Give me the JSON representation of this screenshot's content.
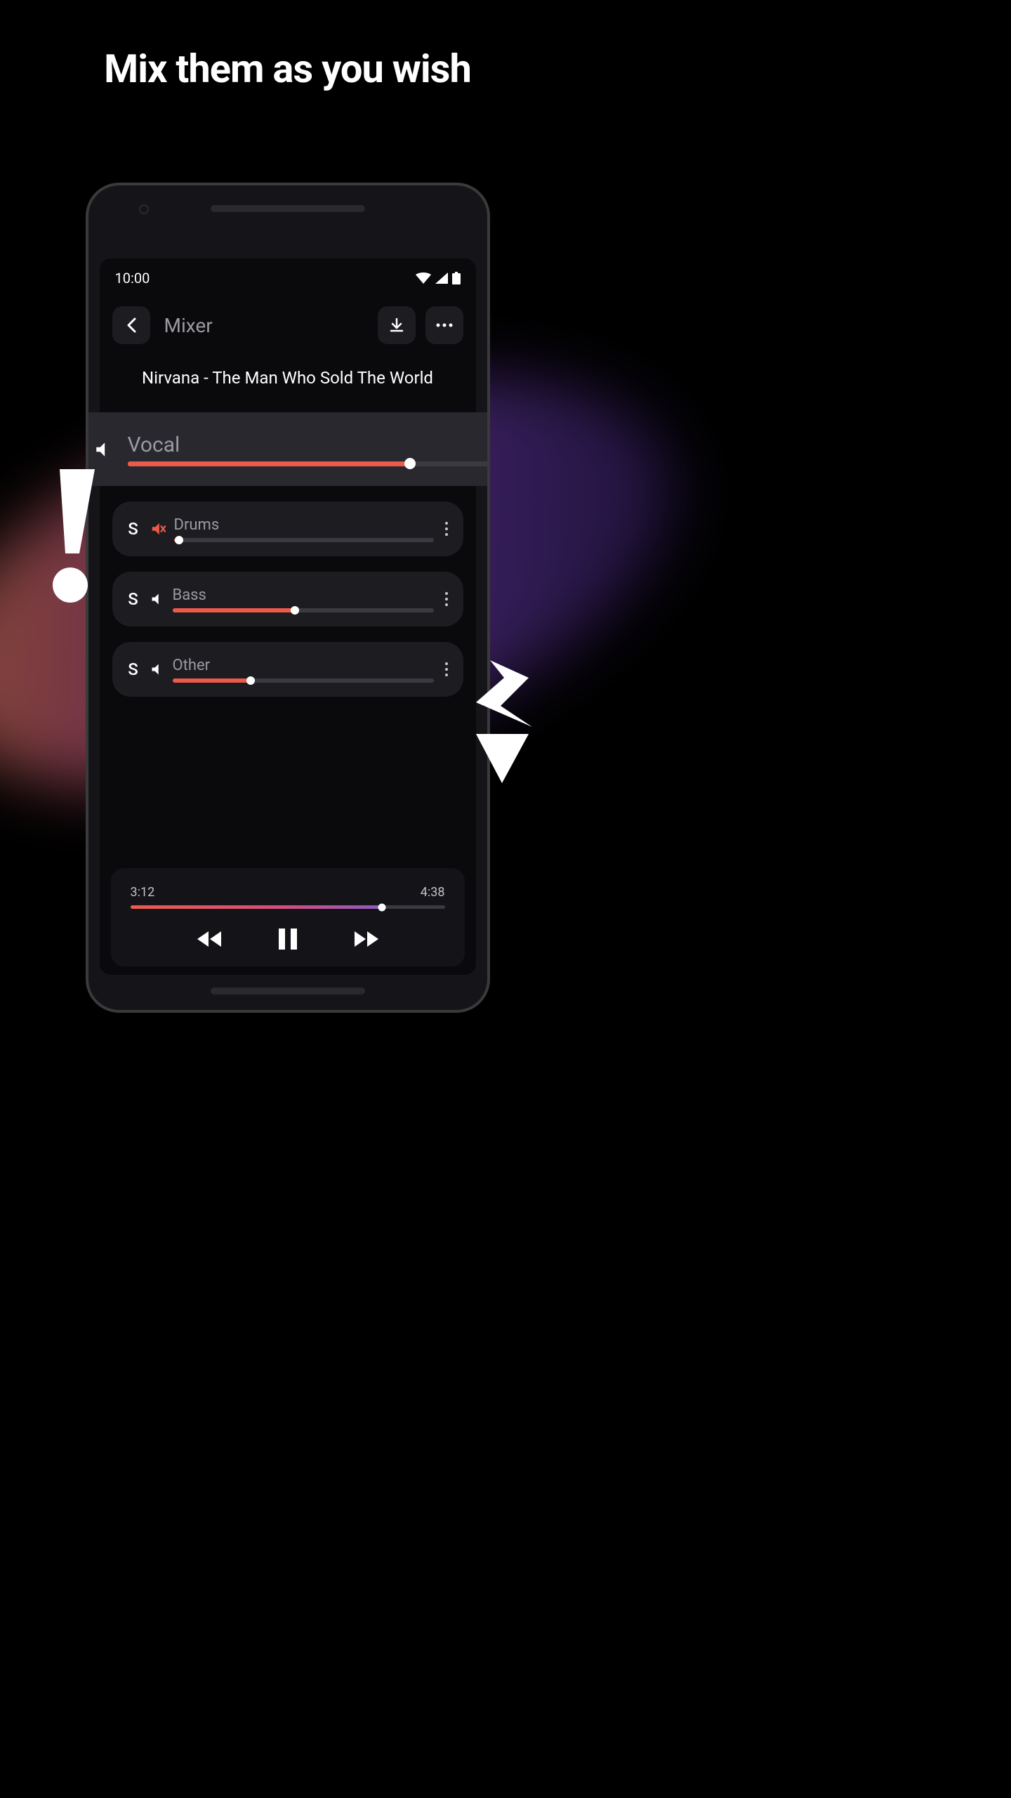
{
  "headline": "Mix them as you wish",
  "status": {
    "time": "10:00"
  },
  "header": {
    "title": "Mixer"
  },
  "song": "Nirvana - The Man Who Sold The World",
  "tracks": [
    {
      "label": "Vocal",
      "level_pct": 78,
      "muted": false,
      "featured": true
    },
    {
      "label": "Drums",
      "level_pct": 2,
      "muted": true,
      "featured": false
    },
    {
      "label": "Bass",
      "level_pct": 47,
      "muted": false,
      "featured": false
    },
    {
      "label": "Other",
      "level_pct": 30,
      "muted": false,
      "featured": false
    }
  ],
  "solo_label": "S",
  "player": {
    "elapsed": "3:12",
    "total": "4:38",
    "progress_pct": 80
  }
}
